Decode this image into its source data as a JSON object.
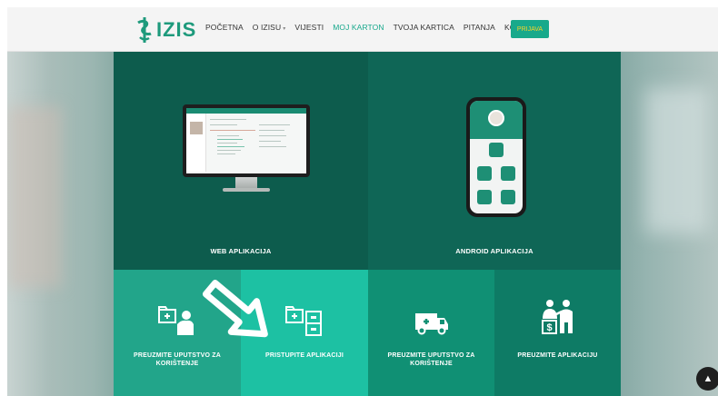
{
  "brand": {
    "name": "IZIS"
  },
  "nav": {
    "items": [
      {
        "label": "POČETNA",
        "active": false
      },
      {
        "label": "O IZISU",
        "active": false,
        "has_dropdown": true
      },
      {
        "label": "VIJESTI",
        "active": false
      },
      {
        "label": "MOJ KARTON",
        "active": true
      },
      {
        "label": "TVOJA KARTICA",
        "active": false
      },
      {
        "label": "PITANJA",
        "active": false
      },
      {
        "label": "KONTAKT",
        "active": false
      }
    ],
    "login_label": "PRIJAVA"
  },
  "panels": {
    "web": {
      "label": "WEB APLIKACIJA"
    },
    "android": {
      "label": "ANDROID APLIKACIJA"
    }
  },
  "cards": [
    {
      "label": "PREUZMITE UPUTSTVO ZA KORIŠTENJE",
      "icon": "folder-person-icon"
    },
    {
      "label": "PRISTUPITE APLIKACIJI",
      "icon": "folder-cabinet-icon"
    },
    {
      "label": "PREUZMITE UPUTSTVO ZA KORIŠTENJE",
      "icon": "ambulance-icon"
    },
    {
      "label": "PREUZMITE APLIKACIJU",
      "icon": "people-money-icon"
    }
  ],
  "colors": {
    "brand_green": "#1e9a7c",
    "login_text": "#f6d32a",
    "web_panel": "#0d5c4d",
    "android_panel": "#0f6656"
  }
}
